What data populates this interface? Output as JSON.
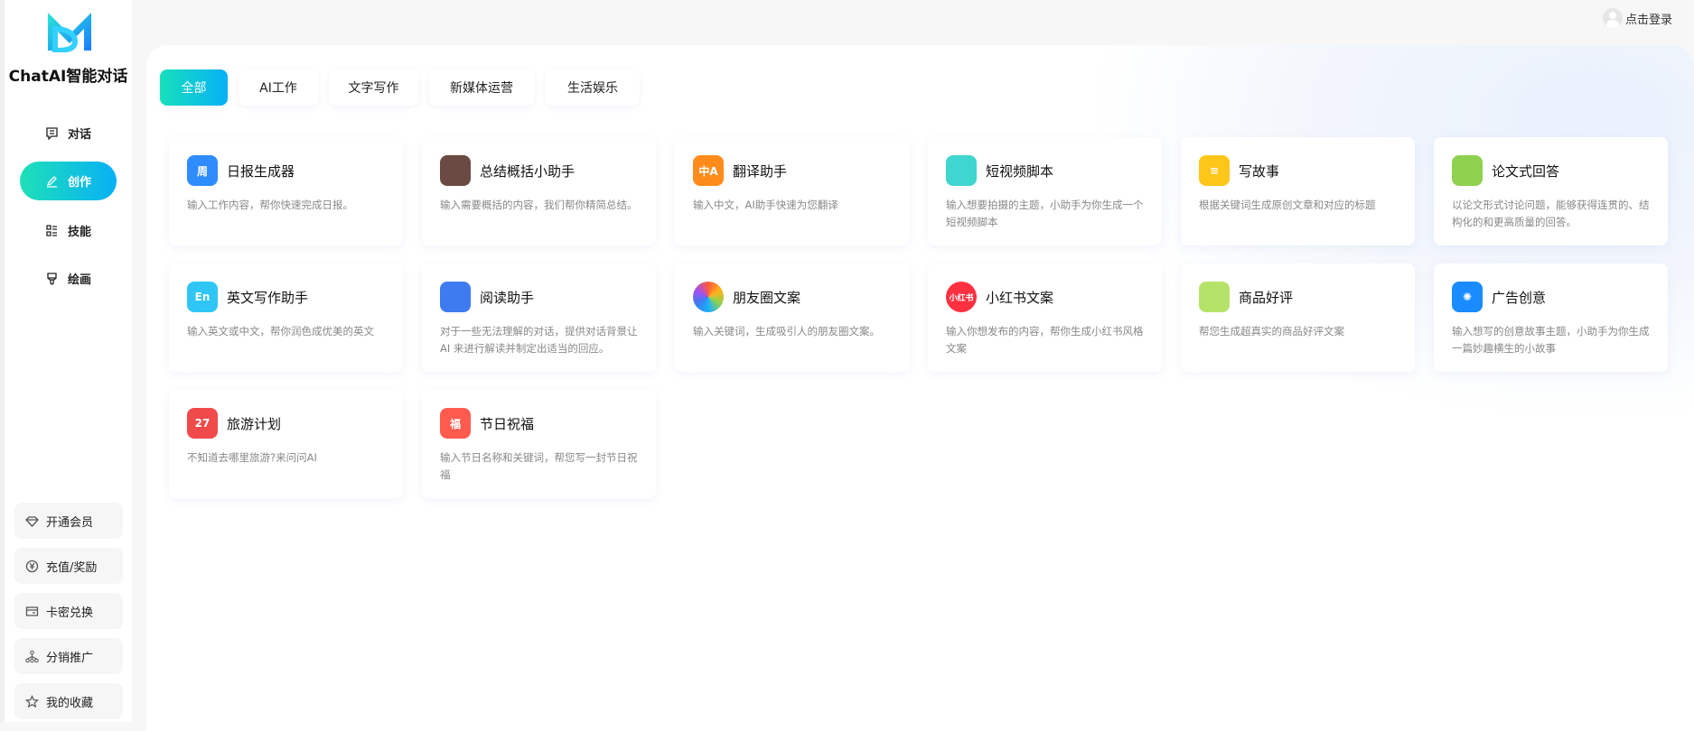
{
  "app": {
    "brand": "ChatAI智能对话",
    "accent": "#08b0f5",
    "accent_start": "#1ee0b8"
  },
  "sidebar": {
    "nav": [
      {
        "label": "对话",
        "icon": "chat-icon"
      },
      {
        "label": "创作",
        "icon": "pen-icon",
        "active": true
      },
      {
        "label": "技能",
        "icon": "grid-list-icon"
      },
      {
        "label": "绘画",
        "icon": "brush-icon"
      }
    ],
    "bottom": [
      {
        "label": "开通会员",
        "icon": "diamond-icon"
      },
      {
        "label": "充值/奖励",
        "icon": "yuan-coin-icon"
      },
      {
        "label": "卡密兑换",
        "icon": "card-icon"
      },
      {
        "label": "分销推广",
        "icon": "network-icon"
      },
      {
        "label": "我的收藏",
        "icon": "star-icon"
      }
    ]
  },
  "header": {
    "login": "点击登录"
  },
  "tabs": [
    {
      "label": "全部",
      "active": true
    },
    {
      "label": "AI工作"
    },
    {
      "label": "文字写作"
    },
    {
      "label": "新媒体运营"
    },
    {
      "label": "生活娱乐"
    }
  ],
  "cards": [
    {
      "title": "日报生成器",
      "desc": "输入工作内容，帮你快速完成日报。",
      "icon": "calendar-week-icon",
      "color": "#2f8cff",
      "glyph": "周"
    },
    {
      "title": "总结概括小助手",
      "desc": "输入需要概括的内容，我们帮你精简总结。",
      "icon": "briefcase-icon",
      "color": "#6b4a44",
      "glyph": ""
    },
    {
      "title": "翻译助手",
      "desc": "输入中文，AI助手快速为您翻译",
      "icon": "translate-icon",
      "color": "#ff8c1a",
      "glyph": "中A"
    },
    {
      "title": "短视频脚本",
      "desc": "输入想要拍摄的主题，小助手为你生成一个短视频脚本",
      "icon": "clapperboard-icon",
      "color": "#3fd6d0",
      "glyph": ""
    },
    {
      "title": "写故事",
      "desc": "根据关键词生成原创文章和对应的标题",
      "icon": "notepad-pencil-icon",
      "color": "#ffc61a",
      "glyph": "≡"
    },
    {
      "title": "论文式回答",
      "desc": "以论文形式讨论问题，能够获得连贯的、结构化的和更高质量的回答。",
      "icon": "binders-icon",
      "color": "#8fd14f",
      "glyph": ""
    },
    {
      "title": "英文写作助手",
      "desc": "输入英文或中文，帮你润色成优美的英文",
      "icon": "en-icon",
      "color": "#2fc6f5",
      "glyph": "En"
    },
    {
      "title": "阅读助手",
      "desc": "对于一些无法理解的对话，提供对话背景让 AI 来进行解读并制定出适当的回应。",
      "icon": "books-icon",
      "color": "#3e7bf0",
      "glyph": ""
    },
    {
      "title": "朋友圈文案",
      "desc": "输入关键词，生成吸引人的朋友圈文案。",
      "icon": "aperture-icon",
      "color": "#ff5a3c",
      "glyph": ""
    },
    {
      "title": "小红书文案",
      "desc": "输入你想发布的内容，帮你生成小红书风格文案",
      "icon": "xiaohongshu-icon",
      "color": "#ff3040",
      "glyph": "小红书"
    },
    {
      "title": "商品好评",
      "desc": "帮您生成超真实的商品好评文案",
      "icon": "shopping-bag-icon",
      "color": "#b5e36a",
      "glyph": ""
    },
    {
      "title": "广告创意",
      "desc": "输入想写的创意故事主题，小助手为你生成一篇妙趣横生的小故事",
      "icon": "lightbulb-icon",
      "color": "#1a8cff",
      "glyph": "✺"
    },
    {
      "title": "旅游计划",
      "desc": "不知道去哪里旅游?来问问AI",
      "icon": "calendar-27-icon",
      "color": "#f04a4a",
      "glyph": "27"
    },
    {
      "title": "节日祝福",
      "desc": "输入节日名称和关键词，帮您写一封节日祝福",
      "icon": "scroll-icon",
      "color": "#ff5a4e",
      "glyph": "福"
    }
  ]
}
